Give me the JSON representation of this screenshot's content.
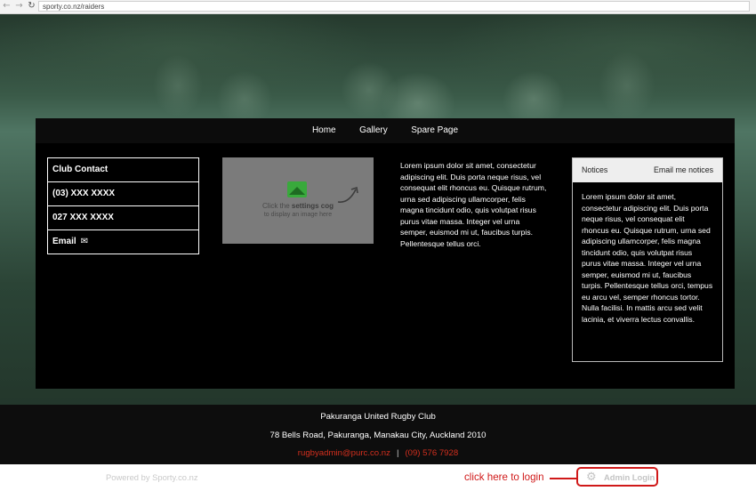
{
  "browser": {
    "back_icon": "←",
    "forward_icon": "→",
    "reload_icon": "↻",
    "url": "sporty.co.nz/raiders"
  },
  "nav": {
    "items": [
      {
        "label": "Home"
      },
      {
        "label": "Gallery"
      },
      {
        "label": "Spare Page"
      }
    ]
  },
  "contact": {
    "title": "Club Contact",
    "phone1": "(03) XXX XXXX",
    "phone2": "027 XXX XXXX",
    "email_label": "Email",
    "email_icon": "✉"
  },
  "image_placeholder": {
    "text_prefix": "Click the ",
    "text_bold": "settings cog",
    "text_line2": "to display an image here"
  },
  "center_text": "Lorem ipsum dolor sit amet, consectetur adipiscing elit. Duis porta neque risus, vel consequat elit rhoncus eu. Quisque rutrum, urna sed adipiscing ullamcorper, felis magna tincidunt odio, quis volutpat risus purus vitae massa. Integer vel urna semper, euismod mi ut, faucibus turpis. Pellentesque tellus orci.",
  "notices": {
    "title": "Notices",
    "email_link": "Email me notices",
    "body": "Lorem ipsum dolor sit amet, consectetur adipiscing elit. Duis porta neque risus, vel consequat elit rhoncus eu. Quisque rutrum, urna sed adipiscing ullamcorper, felis magna tincidunt odio, quis volutpat risus purus vitae massa. Integer vel urna semper, euismod mi ut, faucibus turpis. Pellentesque tellus orci, tempus eu arcu vel, semper rhoncus tortor. Nulla facilisi. In mattis arcu sed velit lacinia, et viverra lectus convallis."
  },
  "footer": {
    "club_name": "Pakuranga United Rugby Club",
    "address": "78 Bells Road, Pakuranga, Manakau City, Auckland 2010",
    "email": "rugbyadmin@purc.co.nz",
    "separator": "|",
    "phone": "(09) 576 7928"
  },
  "bottom": {
    "powered_by": "Powered by Sporty.co.nz",
    "annotation": "click here to login",
    "admin_login": "Admin Login",
    "cog_icon": "⚙"
  },
  "colors": {
    "accent_red": "#d01919",
    "footer_link": "#d32f1e"
  }
}
